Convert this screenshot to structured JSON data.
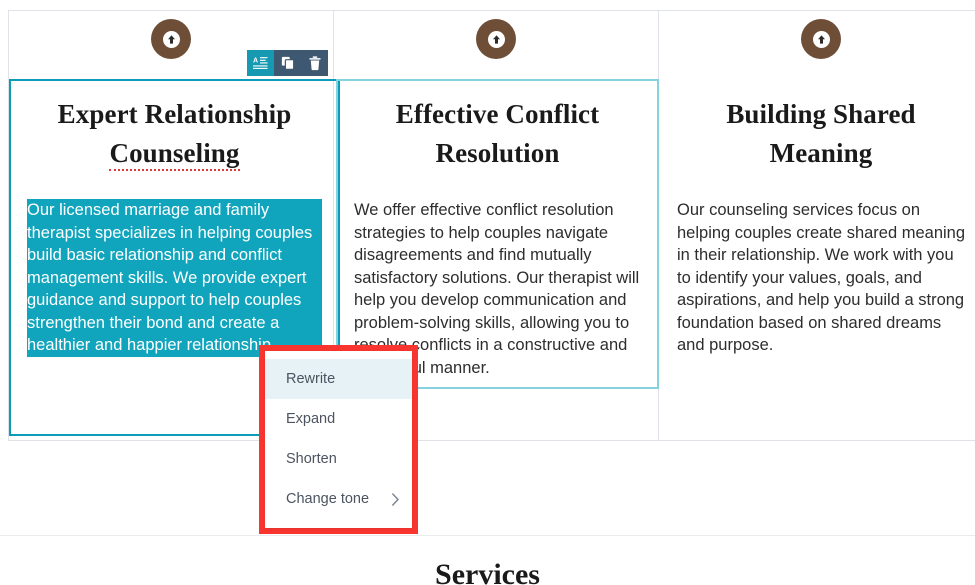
{
  "editor": {
    "badge_icon": "circle-arrow-up-icon",
    "badge_color": "#6f4e37",
    "selected_border_color": "#0d9cb8",
    "hover_border_color": "#86d2df",
    "selection_highlight_color": "#11a5bd",
    "annotation_border_color": "#f8352f",
    "toolbar_background": "#3e5871",
    "toolbar_active_color": "#1799b2"
  },
  "element_toolbar": {
    "buttons": [
      {
        "name": "ai-text-button",
        "icon": "ai-text-icon",
        "label": "AI Text",
        "active": true
      },
      {
        "name": "duplicate-button",
        "icon": "copy-icon",
        "label": "Duplicate",
        "active": false
      },
      {
        "name": "delete-button",
        "icon": "trash-icon",
        "label": "Delete",
        "active": false
      }
    ]
  },
  "ai_menu": {
    "items": [
      {
        "label": "Rewrite",
        "highlighted": true,
        "submenu": false
      },
      {
        "label": "Expand",
        "highlighted": false,
        "submenu": false
      },
      {
        "label": "Shorten",
        "highlighted": false,
        "submenu": false
      },
      {
        "label": "Change tone",
        "highlighted": false,
        "submenu": true
      }
    ]
  },
  "columns": [
    {
      "id": "col-1",
      "state": "selected",
      "heading_lines": [
        "Expert Relationship",
        "Counseling"
      ],
      "heading_misspelled_word": "Counseling",
      "body_selected": true,
      "body_lines": [
        "Our licensed marriage and family",
        "therapist specializes in helping couples",
        "build basic relationship and conflict",
        "management skills. We provide expert",
        "guidance and support to help couples",
        "strengthen their bond and create a",
        "healthier and happier relationship."
      ]
    },
    {
      "id": "col-2",
      "state": "hovered",
      "heading_lines": [
        "Effective Conflict",
        "Resolution"
      ],
      "heading_misspelled_word": "",
      "body_selected": false,
      "body_lines": [
        "We offer effective conflict resolution",
        "strategies to help couples navigate",
        "disagreements and find mutually",
        "satisfactory solutions. Our therapist will",
        "help you develop communication and",
        "problem-solving skills, allowing you to",
        "resolve conflicts in a constructive and",
        "respectful manner."
      ]
    },
    {
      "id": "col-3",
      "state": "plain",
      "heading_lines": [
        "Building Shared",
        "Meaning"
      ],
      "heading_misspelled_word": "",
      "body_selected": false,
      "body_lines": [
        "Our counseling services focus on",
        "helping couples create shared meaning",
        "in their relationship. We work with you",
        "to identify your values, goals, and",
        "aspirations, and help you build a strong",
        "foundation based on shared dreams",
        "and purpose."
      ]
    }
  ],
  "next_section": {
    "heading": "Services"
  }
}
